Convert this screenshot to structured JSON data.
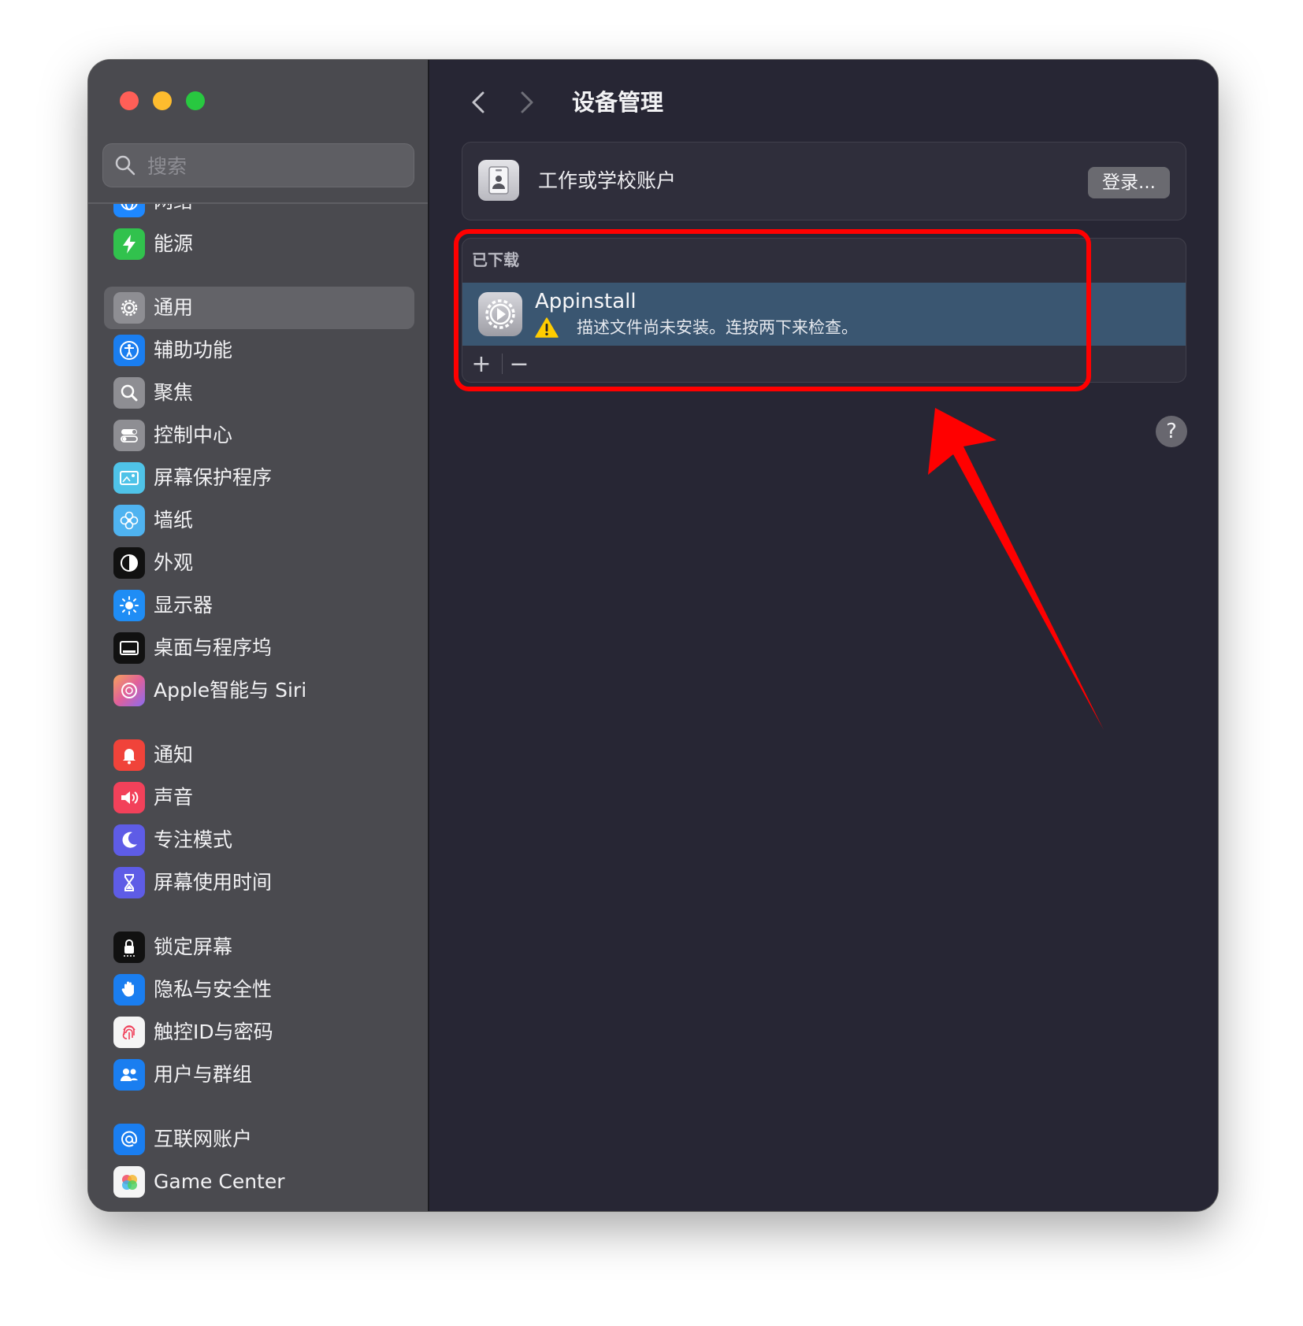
{
  "window": {
    "title": "设备管理"
  },
  "sidebar": {
    "search_placeholder": "搜索",
    "items": [
      {
        "label": "网络",
        "icon": "globe-icon",
        "color": "#1e88ff"
      },
      {
        "label": "能源",
        "icon": "bolt-icon",
        "color": "#31c24d"
      },
      {
        "label": "通用",
        "icon": "gear-icon",
        "color": "#8e8e93",
        "selected": true
      },
      {
        "label": "辅助功能",
        "icon": "accessibility-icon",
        "color": "#1a7ef0"
      },
      {
        "label": "聚焦",
        "icon": "magnifier-icon",
        "color": "#8e8e93"
      },
      {
        "label": "控制中心",
        "icon": "toggles-icon",
        "color": "#8e8e93"
      },
      {
        "label": "屏幕保护程序",
        "icon": "screensaver-icon",
        "color": "#4fc3e8"
      },
      {
        "label": "墙纸",
        "icon": "flower-icon",
        "color": "#4fb3f0"
      },
      {
        "label": "外观",
        "icon": "appearance-icon",
        "color": "#111111"
      },
      {
        "label": "显示器",
        "icon": "sun-icon",
        "color": "#1f8df5"
      },
      {
        "label": "桌面与程序坞",
        "icon": "dock-icon",
        "color": "#111111"
      },
      {
        "label": "Apple智能与 Siri",
        "icon": "siri-icon",
        "color": "#d9739f"
      },
      {
        "label": "通知",
        "icon": "bell-icon",
        "color": "#f0433a"
      },
      {
        "label": "声音",
        "icon": "speaker-icon",
        "color": "#f2415a"
      },
      {
        "label": "专注模式",
        "icon": "moon-icon",
        "color": "#5e5ce6"
      },
      {
        "label": "屏幕使用时间",
        "icon": "hourglass-icon",
        "color": "#5e5ce6"
      },
      {
        "label": "锁定屏幕",
        "icon": "lock-icon",
        "color": "#111111"
      },
      {
        "label": "隐私与安全性",
        "icon": "hand-icon",
        "color": "#1a7ef0"
      },
      {
        "label": "触控ID与密码",
        "icon": "fingerprint-icon",
        "color": "#f5f5f5"
      },
      {
        "label": "用户与群组",
        "icon": "users-icon",
        "color": "#1a7ef0"
      },
      {
        "label": "互联网账户",
        "icon": "at-icon",
        "color": "#1a7ef0"
      },
      {
        "label": "Game Center",
        "icon": "gamecenter-icon",
        "color": "#f5f5f5"
      }
    ]
  },
  "main": {
    "work_account": {
      "label": "工作或学校账户",
      "button": "登录..."
    },
    "downloaded": {
      "header": "已下载",
      "profile": {
        "name": "Appinstall",
        "status": "描述文件尚未安装。连按两下来检查。"
      },
      "add_symbol": "+",
      "remove_symbol": "−"
    },
    "help_symbol": "?"
  },
  "colors": {
    "annotation": "#ff0000",
    "selection": "#3a5671",
    "sidebar_bg": "#4a4a4f",
    "content_bg": "#272634"
  }
}
